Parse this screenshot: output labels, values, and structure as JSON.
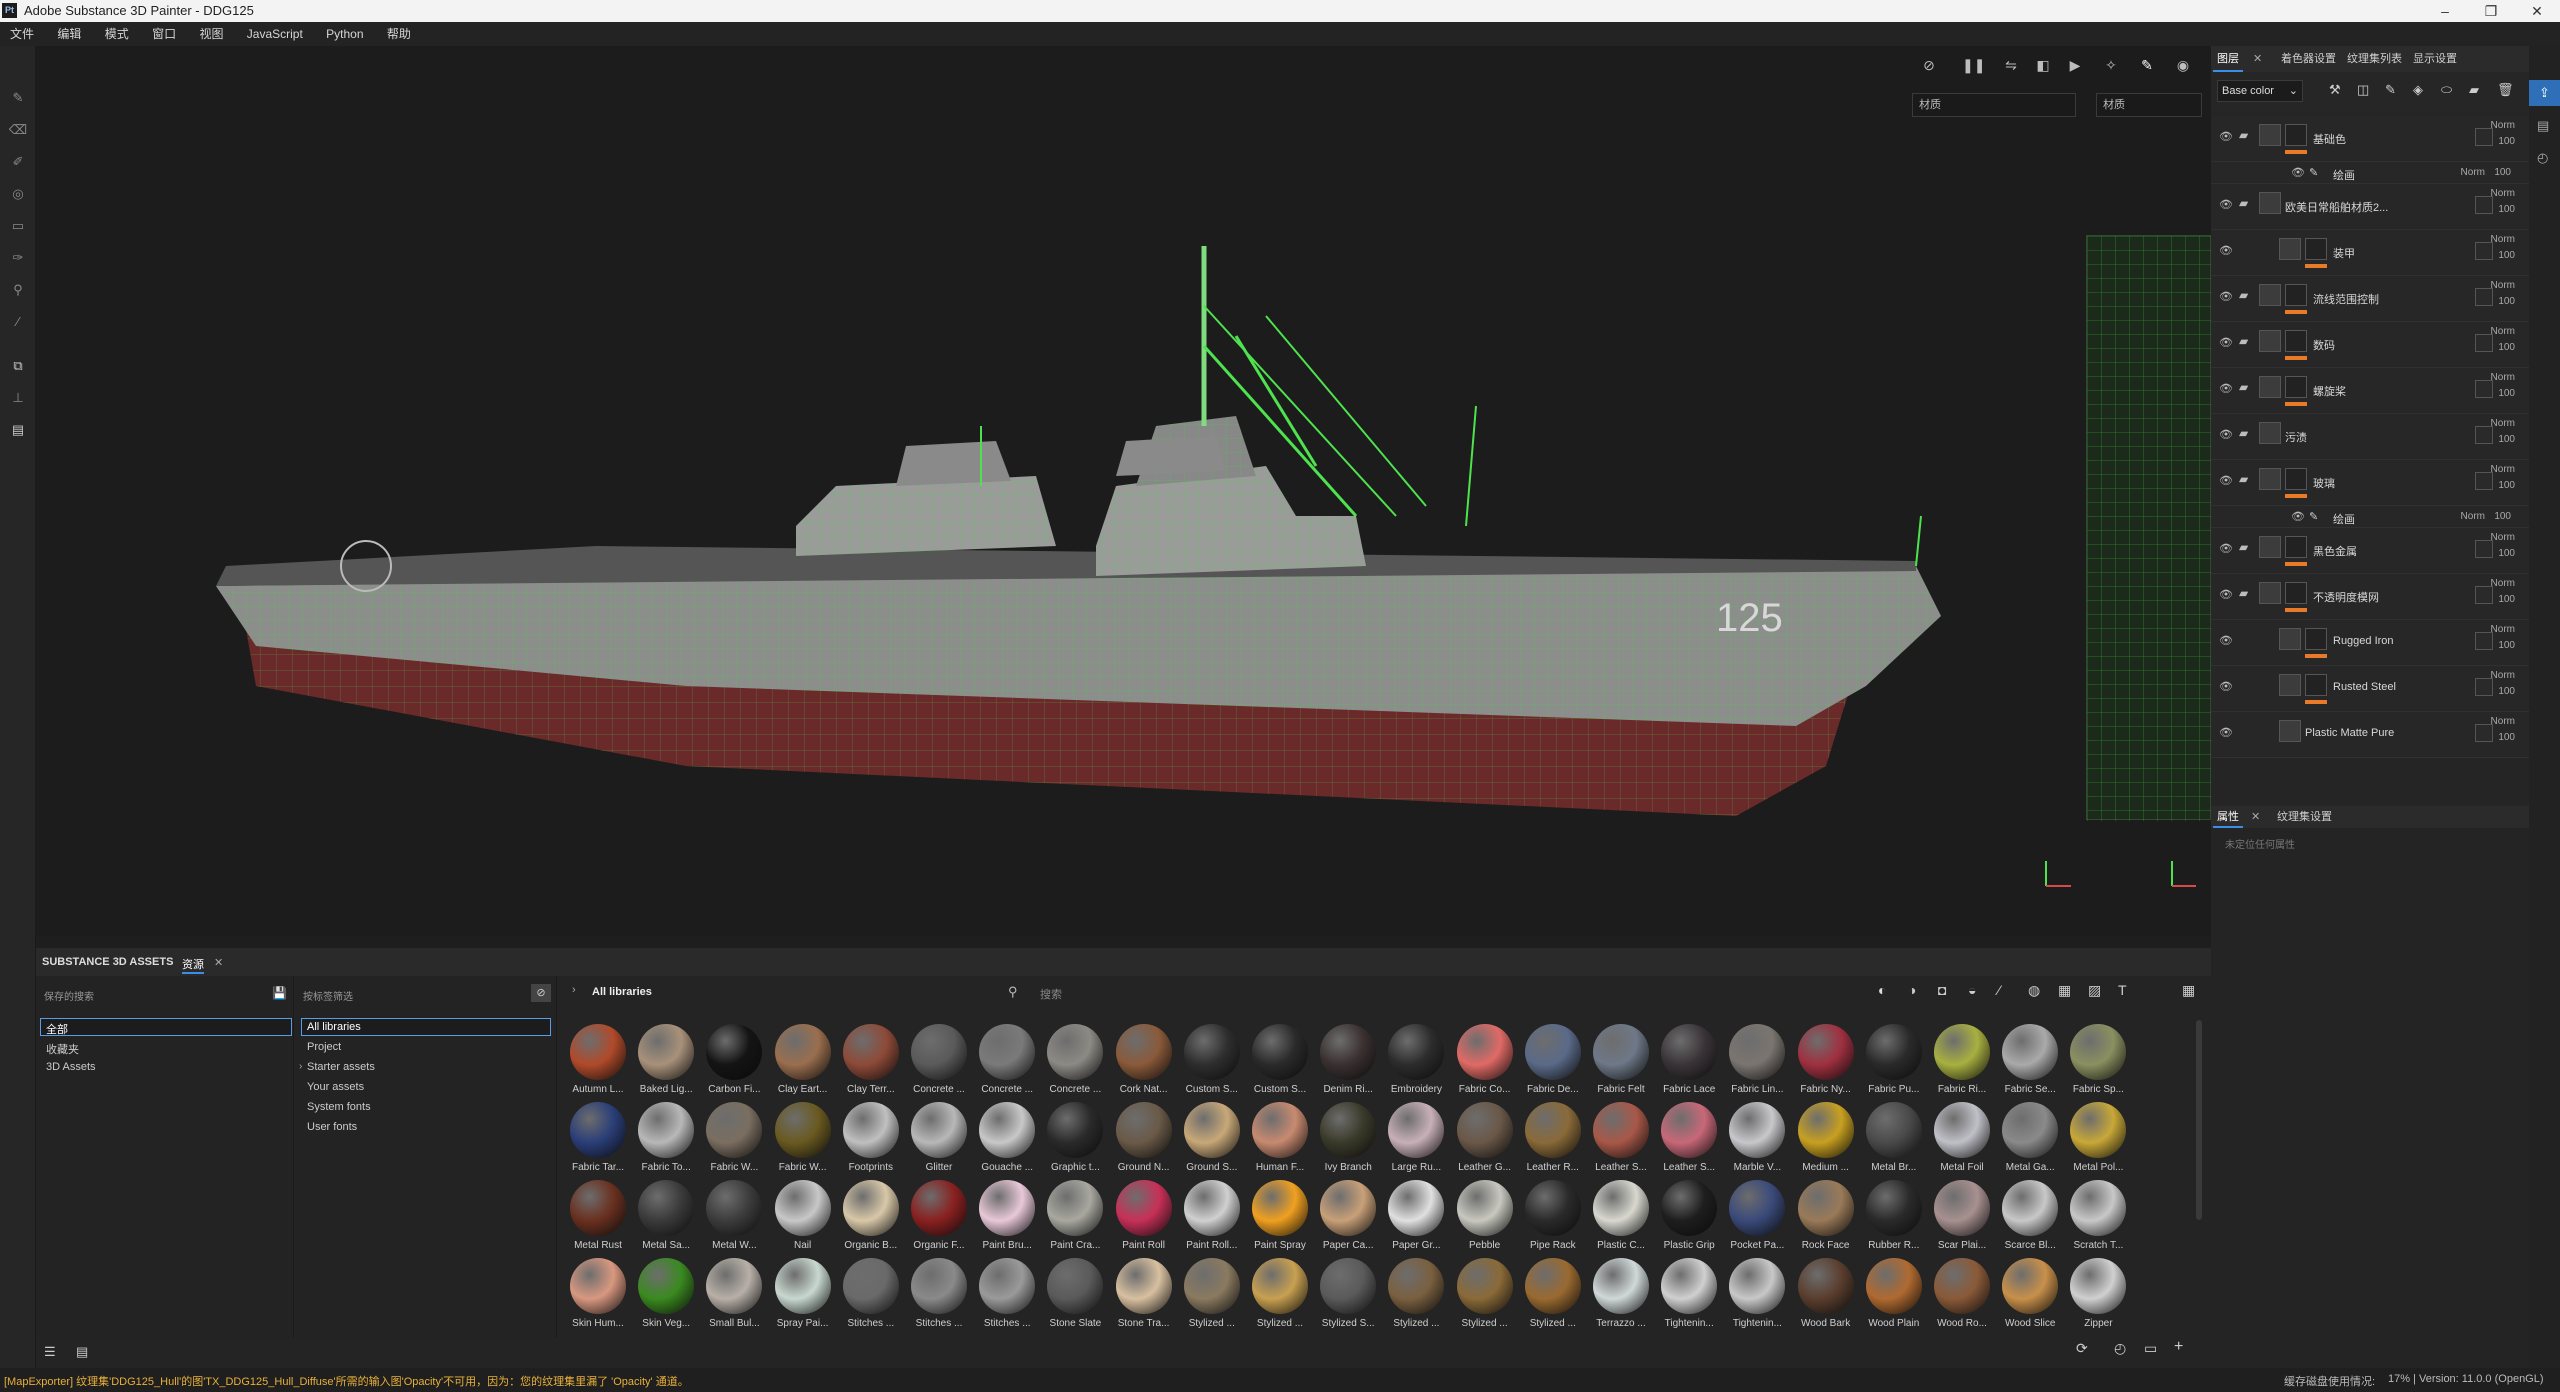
{
  "window": {
    "title": "Adobe Substance 3D Painter - DDG125",
    "app_icon": "Pt",
    "minimize": "–",
    "maximize": "❐",
    "close": "✕"
  },
  "menu": [
    "文件",
    "编辑",
    "模式",
    "窗口",
    "视图",
    "JavaScript",
    "Python",
    "帮助"
  ],
  "viewport": {
    "material_select": "材质",
    "material_select2": "材质",
    "hull_number": "125"
  },
  "right_tabs": [
    "图层",
    "着色器设置",
    "纹理集列表",
    "显示设置"
  ],
  "channel": "Base color",
  "layers": [
    {
      "name": "基础色",
      "blend": "Norm",
      "opacity": "100",
      "type": "folder-mask",
      "accent": true
    },
    {
      "name": "绘画",
      "blend": "Norm",
      "opacity": "100",
      "type": "paint-sub"
    },
    {
      "name": "欧美日常船舶材质2...",
      "blend": "Norm",
      "opacity": "100",
      "type": "folder"
    },
    {
      "name": "装甲",
      "blend": "Norm",
      "opacity": "100",
      "type": "fill-mask",
      "accent": true
    },
    {
      "name": "流线范围控制",
      "blend": "Norm",
      "opacity": "100",
      "type": "folder-mask",
      "accent": true
    },
    {
      "name": "数码",
      "blend": "Norm",
      "opacity": "100",
      "type": "folder-mask",
      "accent": true
    },
    {
      "name": "螺旋桨",
      "blend": "Norm",
      "opacity": "100",
      "type": "folder-mask",
      "accent": true
    },
    {
      "name": "污渍",
      "blend": "Norm",
      "opacity": "100",
      "type": "folder"
    },
    {
      "name": "玻璃",
      "blend": "Norm",
      "opacity": "100",
      "type": "folder-mask",
      "accent": true
    },
    {
      "name": "绘画",
      "blend": "Norm",
      "opacity": "100",
      "type": "paint-sub"
    },
    {
      "name": "黑色金属",
      "blend": "Norm",
      "opacity": "100",
      "type": "folder-mask",
      "accent": true
    },
    {
      "name": "不透明度模网",
      "blend": "Norm",
      "opacity": "100",
      "type": "folder-mask",
      "accent": true
    },
    {
      "name": "Rugged Iron",
      "blend": "Norm",
      "opacity": "100",
      "type": "fill-mask",
      "accent": true
    },
    {
      "name": "Rusted Steel",
      "blend": "Norm",
      "opacity": "100",
      "type": "fill-mask",
      "accent": true
    },
    {
      "name": "Plastic Matte Pure",
      "blend": "Norm",
      "opacity": "100",
      "type": "fill"
    }
  ],
  "props_tabs": [
    "属性",
    "纹理集设置"
  ],
  "props_empty": "未定位任何属性",
  "assets": {
    "panel_title": "SUBSTANCE 3D ASSETS",
    "tab": "资源",
    "saved_search": "保存的搜索",
    "filter_placeholder": "按标签筛选",
    "left_list": [
      "全部",
      "收藏夹",
      "3D Assets"
    ],
    "lib_list": [
      "All libraries",
      "Project",
      "Starter assets",
      "Your assets",
      "System fonts",
      "User fonts"
    ],
    "breadcrumb": "All libraries",
    "search_placeholder": "搜索",
    "materials": [
      {
        "label": "Autumn L...",
        "color": "#b04a2a"
      },
      {
        "label": "Baked Lig...",
        "color": "#a8917a"
      },
      {
        "label": "Carbon Fi...",
        "color": "#141414"
      },
      {
        "label": "Clay Eart...",
        "color": "#9a6e4e"
      },
      {
        "label": "Clay Terr...",
        "color": "#8e4a38"
      },
      {
        "label": "Concrete ...",
        "color": "#5a5a5a"
      },
      {
        "label": "Concrete ...",
        "color": "#7a7a7a"
      },
      {
        "label": "Concrete ...",
        "color": "#8c8a84"
      },
      {
        "label": "Cork Nat...",
        "color": "#8a5a3a"
      },
      {
        "label": "Custom S...",
        "color": "#2e2e2e"
      },
      {
        "label": "Custom S...",
        "color": "#2a2a2a"
      },
      {
        "label": "Denim Ri...",
        "color": "#3a3030"
      },
      {
        "label": "Embroidery",
        "color": "#2c2c2c"
      },
      {
        "label": "Fabric Co...",
        "color": "#e06a66"
      },
      {
        "label": "Fabric De...",
        "color": "#5a6a88"
      },
      {
        "label": "Fabric Felt",
        "color": "#6e7888"
      },
      {
        "label": "Fabric Lace",
        "color": "#3a3438"
      },
      {
        "label": "Fabric Lin...",
        "color": "#7a7570"
      },
      {
        "label": "Fabric Ny...",
        "color": "#a03040"
      },
      {
        "label": "Fabric Pu...",
        "color": "#2a2a2a"
      },
      {
        "label": "Fabric Ri...",
        "color": "#a8b040"
      },
      {
        "label": "Fabric Se...",
        "color": "#aaaaaa"
      },
      {
        "label": "Fabric Sp...",
        "color": "#8a9060"
      },
      {
        "label": "Fabric Tar...",
        "color": "#2a3e78"
      },
      {
        "label": "Fabric To...",
        "color": "#b8b8b8"
      },
      {
        "label": "Fabric W...",
        "color": "#7a6e60"
      },
      {
        "label": "Fabric W...",
        "color": "#6a5a20"
      },
      {
        "label": "Footprints",
        "color": "#c0c0c0"
      },
      {
        "label": "Glitter",
        "color": "#b8b8b8"
      },
      {
        "label": "Gouache ...",
        "color": "#c8c8c8"
      },
      {
        "label": "Graphic t...",
        "color": "#2a2a2a"
      },
      {
        "label": "Ground N...",
        "color": "#6a5a48"
      },
      {
        "label": "Ground S...",
        "color": "#c8a878"
      },
      {
        "label": "Human F...",
        "color": "#c88a70"
      },
      {
        "label": "Ivy Branch",
        "color": "#3a3a2a"
      },
      {
        "label": "Large Ru...",
        "color": "#c8b0b8"
      },
      {
        "label": "Leather G...",
        "color": "#6a5848"
      },
      {
        "label": "Leather R...",
        "color": "#8a6a38"
      },
      {
        "label": "Leather S...",
        "color": "#a85848"
      },
      {
        "label": "Leather S...",
        "color": "#c86878"
      },
      {
        "label": "Marble V...",
        "color": "#c8c8cc"
      },
      {
        "label": "Medium ...",
        "color": "#c8a020"
      },
      {
        "label": "Metal Br...",
        "color": "#4a4a4a"
      },
      {
        "label": "Metal Foil",
        "color": "#c0c0c8"
      },
      {
        "label": "Metal Ga...",
        "color": "#8a8a8a"
      },
      {
        "label": "Metal Pol...",
        "color": "#c8a838"
      },
      {
        "label": "Metal Rust",
        "color": "#6a3020"
      },
      {
        "label": "Metal Sa...",
        "color": "#3a3a3a"
      },
      {
        "label": "Metal W...",
        "color": "#3c3c3c"
      },
      {
        "label": "Nail",
        "color": "#c8c8c8"
      },
      {
        "label": "Organic B...",
        "color": "#d8c8a8"
      },
      {
        "label": "Organic F...",
        "color": "#8a2020"
      },
      {
        "label": "Paint Bru...",
        "color": "#e8c8d8"
      },
      {
        "label": "Paint Cra...",
        "color": "#a8a8a0"
      },
      {
        "label": "Paint Roll",
        "color": "#c83058"
      },
      {
        "label": "Paint Roll...",
        "color": "#d0d0d0"
      },
      {
        "label": "Paint Spray",
        "color": "#f0a020"
      },
      {
        "label": "Paper Ca...",
        "color": "#c8a078"
      },
      {
        "label": "Paper Gr...",
        "color": "#e0e0e0"
      },
      {
        "label": "Pebble",
        "color": "#c8c8c0"
      },
      {
        "label": "Pipe Rack",
        "color": "#2a2a2a"
      },
      {
        "label": "Plastic C...",
        "color": "#d8d8d0"
      },
      {
        "label": "Plastic Grip",
        "color": "#1e1e1e"
      },
      {
        "label": "Pocket Pa...",
        "color": "#3a4a7a"
      },
      {
        "label": "Rock Face",
        "color": "#9a7a58"
      },
      {
        "label": "Rubber R...",
        "color": "#2a2a2a"
      },
      {
        "label": "Scar Plai...",
        "color": "#a89090"
      },
      {
        "label": "Scarce Bl...",
        "color": "#c8c8c8"
      },
      {
        "label": "Scratch T...",
        "color": "#c8c8c8"
      },
      {
        "label": "Skin Hum...",
        "color": "#d89880"
      },
      {
        "label": "Skin Veg...",
        "color": "#3a8a20"
      },
      {
        "label": "Small Bul...",
        "color": "#b8b0a8"
      },
      {
        "label": "Spray Pai...",
        "color": "#c8d8d0"
      },
      {
        "label": "Stitches ...",
        "color": "#6a6a6a"
      },
      {
        "label": "Stitches ...",
        "color": "#8a8a8a"
      },
      {
        "label": "Stitches ...",
        "color": "#9a9a9a"
      },
      {
        "label": "Stone Slate",
        "color": "#5a5a5a"
      },
      {
        "label": "Stone Tra...",
        "color": "#d8c0a0"
      },
      {
        "label": "Stylized ...",
        "color": "#8a7a60"
      },
      {
        "label": "Stylized ...",
        "color": "#c8a050"
      },
      {
        "label": "Stylized S...",
        "color": "#5a5a5a"
      },
      {
        "label": "Stylized ...",
        "color": "#7a6040"
      },
      {
        "label": "Stylized ...",
        "color": "#8a6a38"
      },
      {
        "label": "Stylized ...",
        "color": "#9a6a30"
      },
      {
        "label": "Terrazzo ...",
        "color": "#d0d8d8"
      },
      {
        "label": "Tightenin...",
        "color": "#d0d0d0"
      },
      {
        "label": "Tightenin...",
        "color": "#c8c8c8"
      },
      {
        "label": "Wood Bark",
        "color": "#5a3e2e"
      },
      {
        "label": "Wood Plain",
        "color": "#b06a30"
      },
      {
        "label": "Wood Ro...",
        "color": "#8a5a38"
      },
      {
        "label": "Wood Slice",
        "color": "#c8904a"
      },
      {
        "label": "Zipper",
        "color": "#d0d0d0"
      }
    ]
  },
  "status": {
    "message": "[MapExporter] 纹理集'DDG125_Hull'的图'TX_DDG125_Hull_Diffuse'所需的输入图'Opacity'不可用，因为：您的纹理集里漏了 'Opacity' 通道。",
    "cache": "缓存磁盘使用情况:",
    "usage": "17% | Version: 11.0.0 (OpenGL)"
  }
}
